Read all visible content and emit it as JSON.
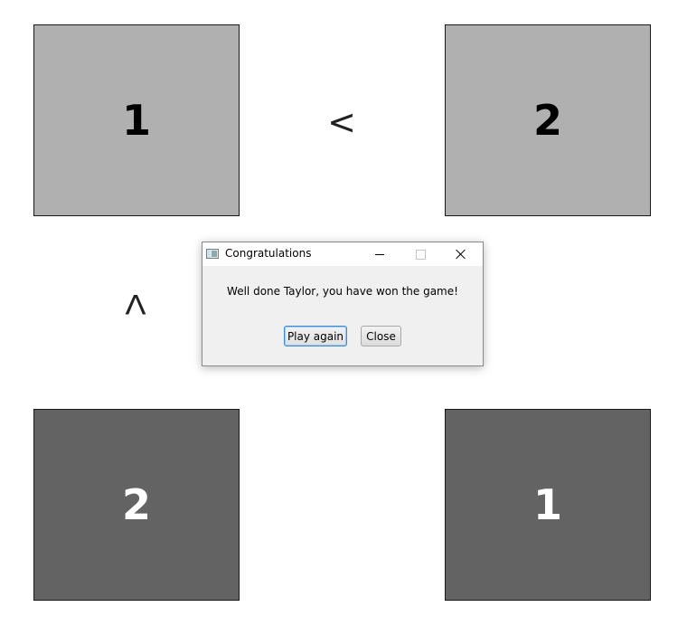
{
  "board": {
    "cells": {
      "top_left": "1",
      "top_right": "2",
      "bottom_left": "2",
      "bottom_right": "1"
    },
    "constraints": {
      "horizontal": "<",
      "vertical": "Λ"
    },
    "colors": {
      "light_cell": "#b0b0b0",
      "dark_cell": "#636363"
    }
  },
  "dialog": {
    "title": "Congratulations",
    "message": "Well done Taylor, you have won the game!",
    "buttons": {
      "play_again": "Play again",
      "close": "Close"
    },
    "icons": {
      "app": "window-app-icon",
      "minimize": "minimize-icon",
      "maximize": "maximize-icon",
      "close": "close-icon"
    }
  }
}
